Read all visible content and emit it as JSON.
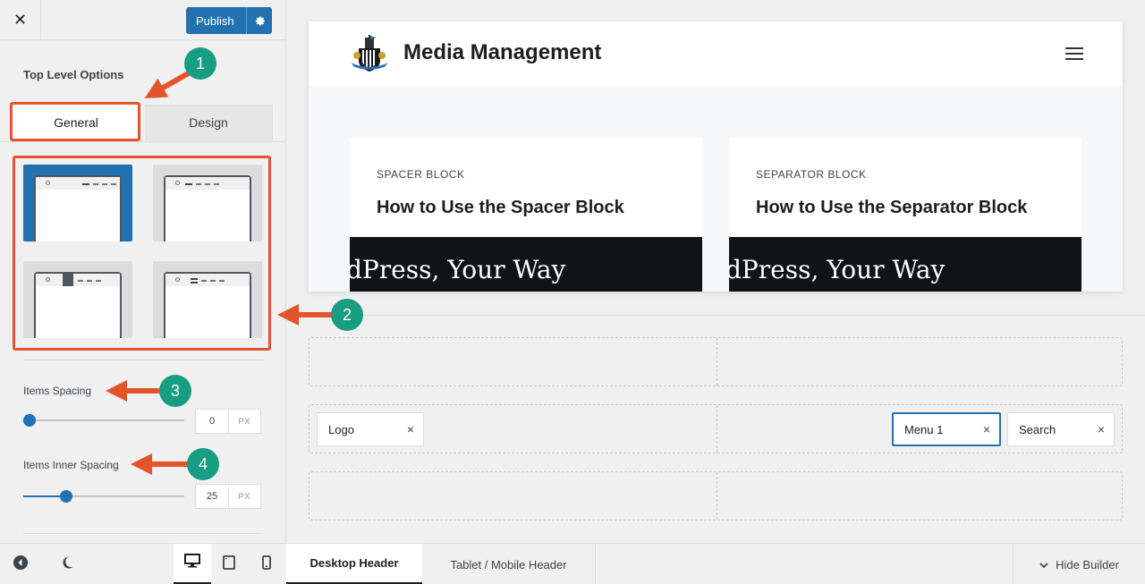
{
  "sidebar": {
    "close_glyph": "✕",
    "publish_label": "Publish",
    "section_title": "Top Level Options",
    "tabs": [
      {
        "label": "General",
        "active": true
      },
      {
        "label": "Design",
        "active": false
      }
    ],
    "layouts": [
      {
        "name": "layout-logo-left-menu-right",
        "selected": true
      },
      {
        "name": "layout-logo-left-menu-left",
        "selected": false
      },
      {
        "name": "layout-logo-left-menu-highlighted",
        "selected": false
      },
      {
        "name": "layout-logo-left-menu-center",
        "selected": false
      }
    ],
    "items_spacing": {
      "label": "Items Spacing",
      "value": "0",
      "unit": "PX"
    },
    "items_inner_spacing": {
      "label": "Items Inner Spacing",
      "value": "25",
      "unit": "PX"
    }
  },
  "annotations": [
    "1",
    "2",
    "3",
    "4"
  ],
  "preview": {
    "site_title": "Media Management",
    "cards": [
      {
        "category": "SPACER BLOCK",
        "title": "How to Use the Spacer Block",
        "banner": "dPress, Your Way"
      },
      {
        "category": "SEPARATOR BLOCK",
        "title": "How to Use the Separator Block",
        "banner": "dPress, Your Way"
      }
    ]
  },
  "builder": {
    "chips": [
      {
        "label": "Logo",
        "close": "×"
      },
      {
        "label": "Menu 1",
        "close": "×"
      },
      {
        "label": "Search",
        "close": "×"
      }
    ]
  },
  "footer": {
    "tabs": [
      "Desktop Header",
      "Tablet / Mobile Header"
    ],
    "hide_builder": "Hide Builder"
  },
  "colors": {
    "accent": "#2271b1",
    "annotation_red": "#e4542b",
    "annotation_badge": "#179d82"
  }
}
